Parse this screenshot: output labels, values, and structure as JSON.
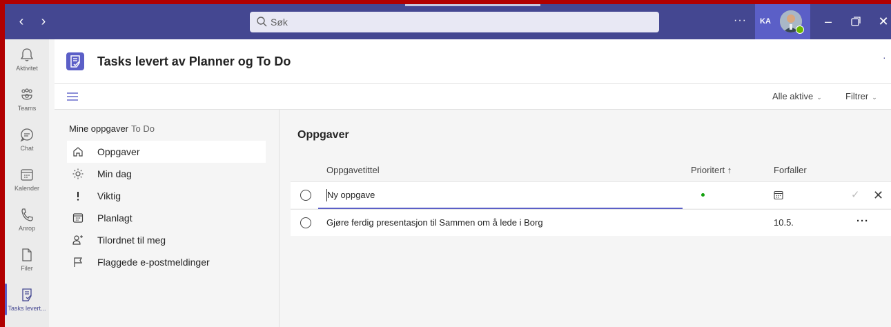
{
  "topbar": {
    "search_placeholder": "Søk",
    "more": "···",
    "account_initials": "KA"
  },
  "rail": {
    "items": [
      {
        "label": "Aktivitet",
        "icon": "bell-icon"
      },
      {
        "label": "Teams",
        "icon": "teams-icon"
      },
      {
        "label": "Chat",
        "icon": "chat-icon"
      },
      {
        "label": "Kalender",
        "icon": "calendar-icon"
      },
      {
        "label": "Anrop",
        "icon": "phone-icon"
      },
      {
        "label": "Filer",
        "icon": "file-icon"
      },
      {
        "label": "Tasks levert...",
        "icon": "tasks-icon"
      }
    ]
  },
  "app": {
    "title": "Tasks levert av Planner og To Do",
    "more": "·"
  },
  "toolbar": {
    "filter_active": "Alle aktive",
    "filter": "Filtrer"
  },
  "sidebar": {
    "heading": "Mine oppgaver",
    "heading_sub": "To Do",
    "items": [
      {
        "label": "Oppgaver",
        "icon": "home-icon"
      },
      {
        "label": "Min dag",
        "icon": "sun-icon"
      },
      {
        "label": "Viktig",
        "icon": "exclamation-icon"
      },
      {
        "label": "Planlagt",
        "icon": "calendar-icon"
      },
      {
        "label": "Tilordnet til meg",
        "icon": "person-add-icon"
      },
      {
        "label": "Flaggede e-postmeldinger",
        "icon": "flag-icon"
      }
    ]
  },
  "main": {
    "title": "Oppgaver",
    "columns": {
      "title": "Oppgavetittel",
      "priority": "Prioritert ↑",
      "due": "Forfaller"
    },
    "new_task_placeholder": "Ny oppgave",
    "tasks": [
      {
        "title": "Gjøre ferdig presentasjon til Sammen om å lede i Borg",
        "due": "10.5.",
        "more": "···"
      }
    ]
  },
  "colors": {
    "frame": "#b10000",
    "titlebar": "#444791",
    "accent": "#5b5fc7"
  }
}
